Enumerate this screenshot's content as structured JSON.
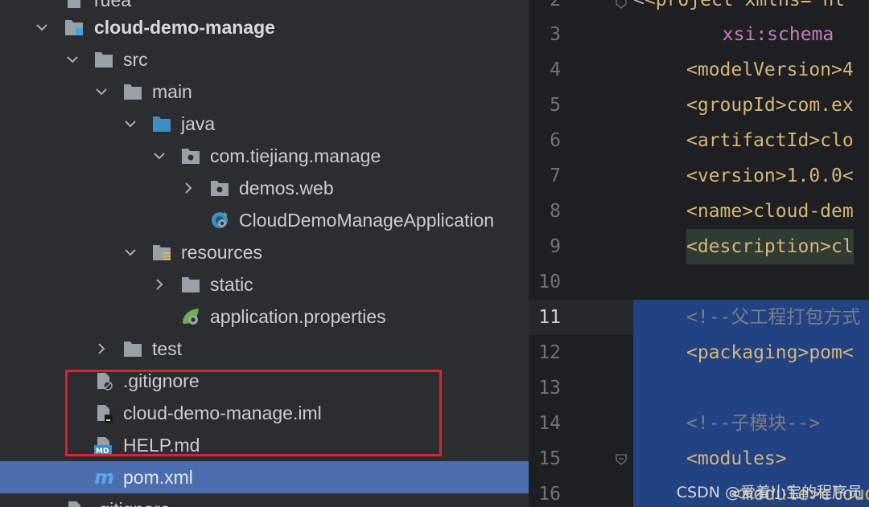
{
  "tree": {
    "items": [
      {
        "label": "ruea"
      },
      {
        "label": "cloud-demo-manage"
      },
      {
        "label": "src"
      },
      {
        "label": "main"
      },
      {
        "label": "java"
      },
      {
        "label": "com.tiejiang.manage"
      },
      {
        "label": "demos.web"
      },
      {
        "label": "CloudDemoManageApplication"
      },
      {
        "label": "resources"
      },
      {
        "label": "static"
      },
      {
        "label": "application.properties"
      },
      {
        "label": "test"
      },
      {
        "label": ".gitignore"
      },
      {
        "label": "cloud-demo-manage.iml"
      },
      {
        "label": "HELP.md"
      },
      {
        "label": "pom.xml"
      },
      {
        "label": ".gitignore"
      }
    ]
  },
  "editor": {
    "current_line": "11",
    "lines": [
      {
        "num": "2",
        "text": "<project xmlns=\"ht"
      },
      {
        "num": "3",
        "text": "        xsi:schema"
      },
      {
        "num": "4",
        "text": "<modelVersion>4"
      },
      {
        "num": "5",
        "text": "<groupId>com.ex"
      },
      {
        "num": "6",
        "text": "<artifactId>clo"
      },
      {
        "num": "7",
        "text": "<version>1.0.0<"
      },
      {
        "num": "8",
        "text": "<name>cloud-dem"
      },
      {
        "num": "9",
        "text": "<description>cl"
      },
      {
        "num": "10",
        "text": ""
      },
      {
        "num": "11",
        "text": "<!--父工程打包方式"
      },
      {
        "num": "12",
        "text": "<packaging>pom<"
      },
      {
        "num": "13",
        "text": ""
      },
      {
        "num": "14",
        "text": "<!--子模块-->"
      },
      {
        "num": "15",
        "text": "<modules>"
      },
      {
        "num": "16",
        "text": "    <module>cloud"
      }
    ]
  },
  "watermark": "CSDN @爱着小宝的程序员",
  "colors": {
    "tag": "#d5b778",
    "bracket": "#bcbec4",
    "comment": "#7a7e85",
    "attr": "#bababa",
    "selection": "#214283",
    "tree_selected": "#4b6eaf",
    "red_box": "#e0202a"
  }
}
